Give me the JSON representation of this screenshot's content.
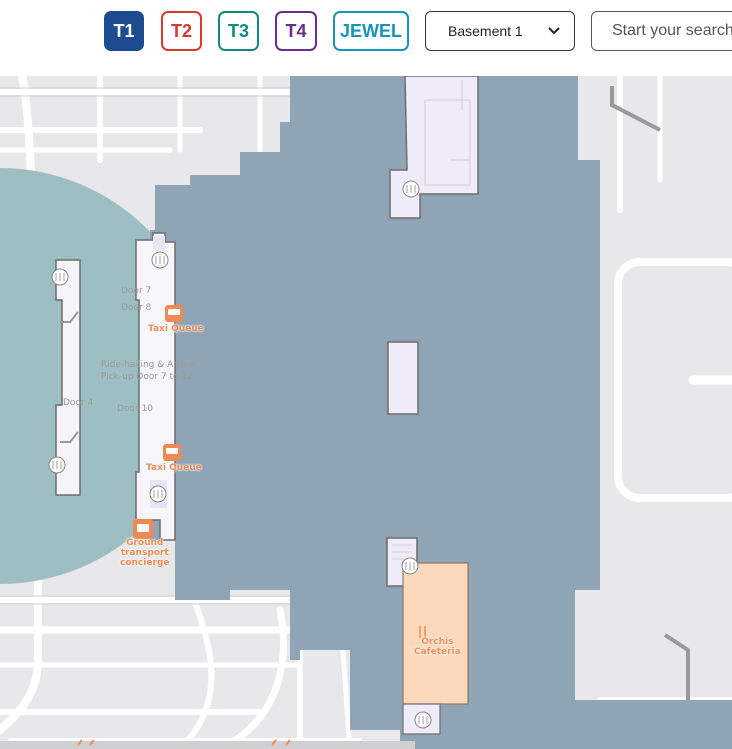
{
  "terminals": [
    {
      "label": "T1",
      "color": "#1d4b8f",
      "active": true
    },
    {
      "label": "T2",
      "color": "#d9382f",
      "active": false
    },
    {
      "label": "T3",
      "color": "#138a80",
      "active": false
    },
    {
      "label": "T4",
      "color": "#6b2c8a",
      "active": false
    },
    {
      "label": "JEWEL",
      "color": "#1a93b8",
      "active": false
    }
  ],
  "level_select": {
    "value": "Basement 1"
  },
  "search": {
    "placeholder": "Start your search"
  },
  "map": {
    "labels": {
      "door7": "Door 7",
      "door8": "Door 8",
      "door4": "Door 4",
      "door10": "Door 10",
      "ride_hailing_1": "Ride-hailing & Arrival",
      "ride_hailing_2": "Pick-up  Door 7 to 12"
    },
    "poi": {
      "taxi_queue_1": "Taxi Queue",
      "taxi_queue_2": "Taxi Queue",
      "ground_transport_1": "Ground",
      "ground_transport_2": "transport",
      "ground_transport_3": "concierge",
      "cafeteria_1": "Orchis",
      "cafeteria_2": "Cafeteria"
    }
  }
}
